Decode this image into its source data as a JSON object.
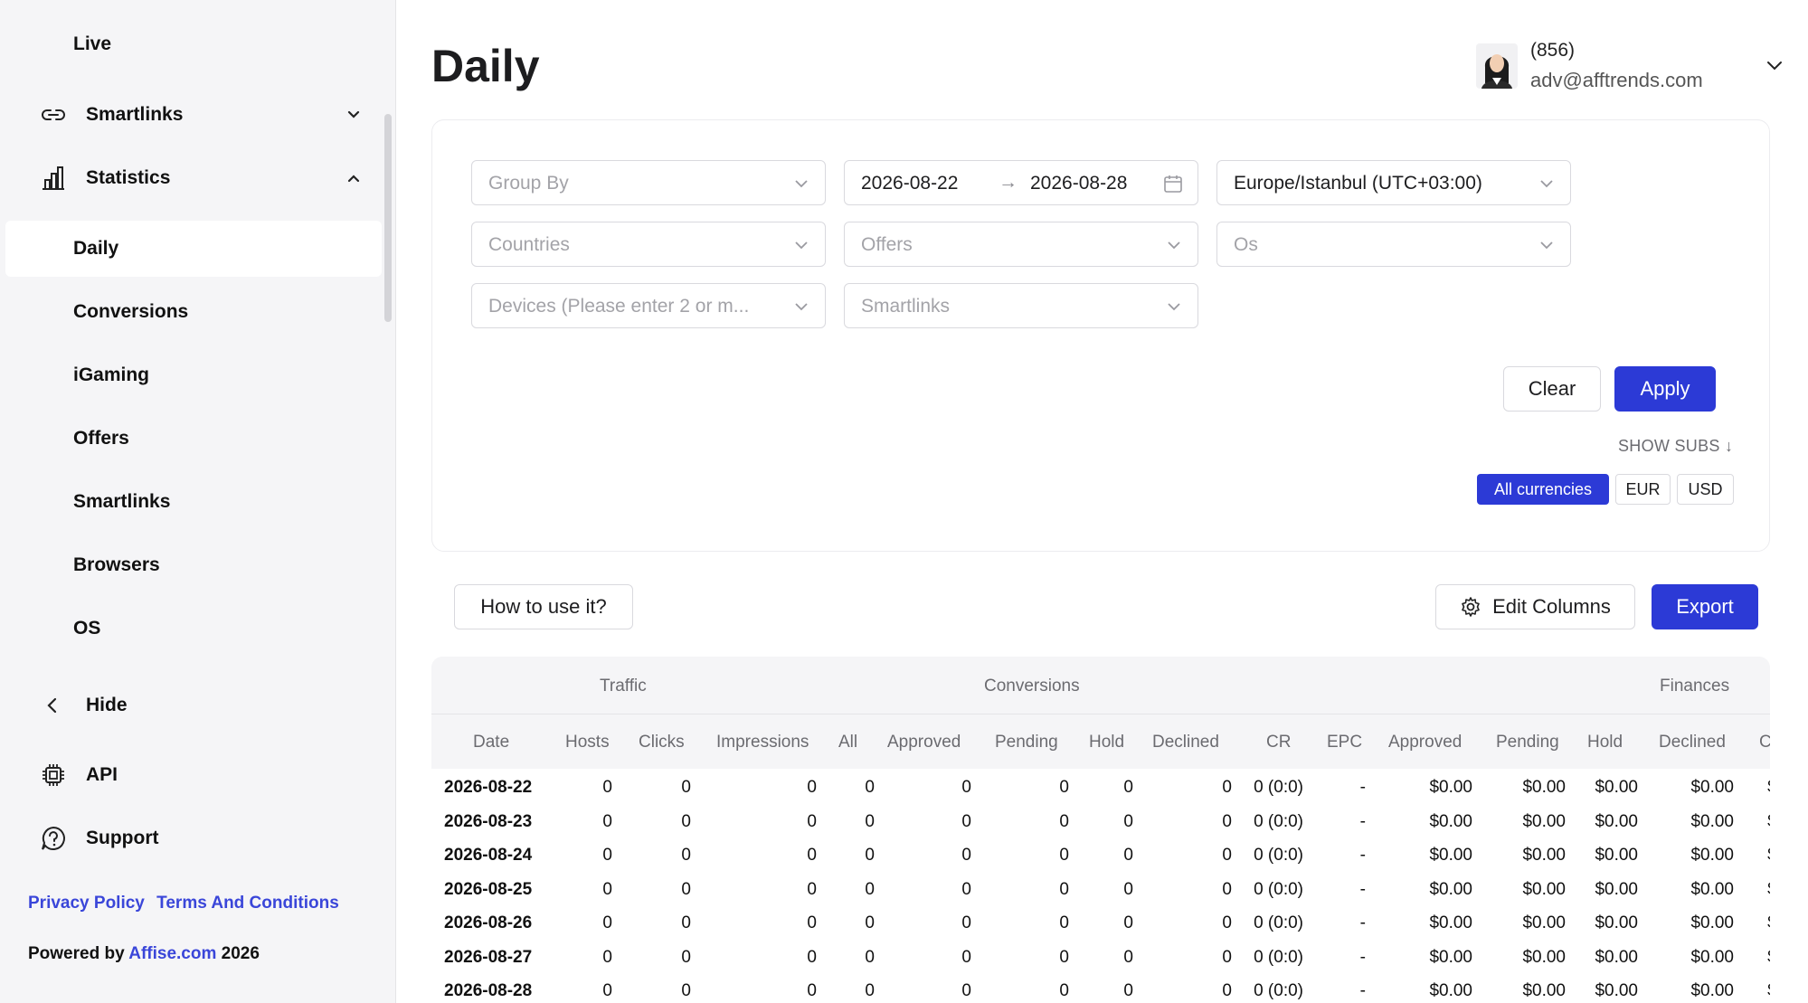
{
  "sidebar": {
    "top_item": "Live",
    "smartlinks": "Smartlinks",
    "statistics": "Statistics",
    "sub_items": [
      "Daily",
      "Conversions",
      "iGaming",
      "Offers",
      "Smartlinks",
      "Browsers",
      "OS"
    ],
    "hide": "Hide",
    "api": "API",
    "support": "Support",
    "privacy": "Privacy Policy",
    "terms": "Terms And Conditions",
    "powered_prefix": "Powered by",
    "powered_link": "Affise.com",
    "powered_year": "2026"
  },
  "header": {
    "title": "Daily",
    "user_code": "(856)",
    "user_email": "adv@afftrends.com"
  },
  "filters": {
    "group_by": "Group By",
    "date_from": "2026-08-22",
    "date_arrow": "→",
    "date_to": "2026-08-28",
    "timezone": "Europe/Istanbul (UTC+03:00)",
    "countries": "Countries",
    "offers": "Offers",
    "os": "Os",
    "devices": "Devices (Please enter 2 or m...",
    "smartlinks": "Smartlinks",
    "clear": "Clear",
    "apply": "Apply",
    "show_subs": "SHOW SUBS",
    "currencies": [
      "All currencies",
      "EUR",
      "USD"
    ]
  },
  "actions": {
    "how_to": "How to use it?",
    "edit_columns": "Edit Columns",
    "export": "Export"
  },
  "table": {
    "groups": [
      "Traffic",
      "Conversions",
      "Finances"
    ],
    "columns": [
      "Date",
      "Hosts",
      "Clicks",
      "Impressions",
      "All",
      "Approved",
      "Pending",
      "Hold",
      "Declined",
      "CR",
      "EPC",
      "Approved",
      "Pending",
      "Hold",
      "Declined",
      "Cl"
    ],
    "rows": [
      [
        "2026-08-22",
        "0",
        "0",
        "0",
        "0",
        "0",
        "0",
        "0",
        "0",
        "0 (0:0)",
        "-",
        "$0.00",
        "$0.00",
        "$0.00",
        "$0.00",
        "$("
      ],
      [
        "2026-08-23",
        "0",
        "0",
        "0",
        "0",
        "0",
        "0",
        "0",
        "0",
        "0 (0:0)",
        "-",
        "$0.00",
        "$0.00",
        "$0.00",
        "$0.00",
        "$("
      ],
      [
        "2026-08-24",
        "0",
        "0",
        "0",
        "0",
        "0",
        "0",
        "0",
        "0",
        "0 (0:0)",
        "-",
        "$0.00",
        "$0.00",
        "$0.00",
        "$0.00",
        "$("
      ],
      [
        "2026-08-25",
        "0",
        "0",
        "0",
        "0",
        "0",
        "0",
        "0",
        "0",
        "0 (0:0)",
        "-",
        "$0.00",
        "$0.00",
        "$0.00",
        "$0.00",
        "$("
      ],
      [
        "2026-08-26",
        "0",
        "0",
        "0",
        "0",
        "0",
        "0",
        "0",
        "0",
        "0 (0:0)",
        "-",
        "$0.00",
        "$0.00",
        "$0.00",
        "$0.00",
        "$("
      ],
      [
        "2026-08-27",
        "0",
        "0",
        "0",
        "0",
        "0",
        "0",
        "0",
        "0",
        "0 (0:0)",
        "-",
        "$0.00",
        "$0.00",
        "$0.00",
        "$0.00",
        "$("
      ],
      [
        "2026-08-28",
        "0",
        "0",
        "0",
        "0",
        "0",
        "0",
        "0",
        "0",
        "0 (0:0)",
        "-",
        "$0.00",
        "$0.00",
        "$0.00",
        "$0.00",
        "$("
      ]
    ]
  },
  "colors": {
    "accent": "#2c3ad6",
    "link": "#3a46d9",
    "sidebar_bg": "#f5f5f7"
  }
}
